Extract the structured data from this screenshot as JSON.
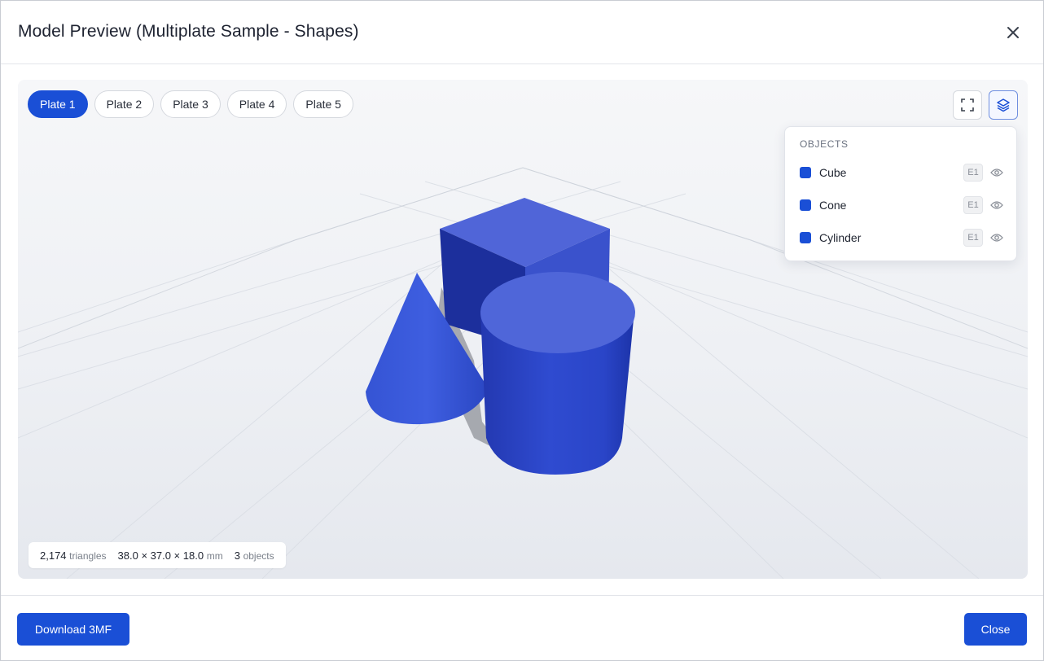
{
  "modal": {
    "title": "Model Preview (Multiplate Sample - Shapes)",
    "close_icon": "close-icon"
  },
  "plates": [
    {
      "label": "Plate 1",
      "active": true
    },
    {
      "label": "Plate 2",
      "active": false
    },
    {
      "label": "Plate 3",
      "active": false
    },
    {
      "label": "Plate 4",
      "active": false
    },
    {
      "label": "Plate 5",
      "active": false
    }
  ],
  "toolbar": {
    "fullscreen_icon": "fullscreen-icon",
    "layers_icon": "layers-icon"
  },
  "objects_panel": {
    "heading": "OBJECTS",
    "items": [
      {
        "name": "Cube",
        "extruder": "E1",
        "color": "#1a4fd6"
      },
      {
        "name": "Cone",
        "extruder": "E1",
        "color": "#1a4fd6"
      },
      {
        "name": "Cylinder",
        "extruder": "E1",
        "color": "#1a4fd6"
      }
    ]
  },
  "stats": {
    "triangles_value": "2,174",
    "triangles_unit": "triangles",
    "dimensions_value": "38.0 × 37.0 × 18.0",
    "dimensions_unit": "mm",
    "objects_value": "3",
    "objects_unit": "objects"
  },
  "footer": {
    "download_label": "Download 3MF",
    "close_label": "Close"
  },
  "colors": {
    "accent": "#1a4fd6",
    "model_blue": "#2a44c8"
  }
}
